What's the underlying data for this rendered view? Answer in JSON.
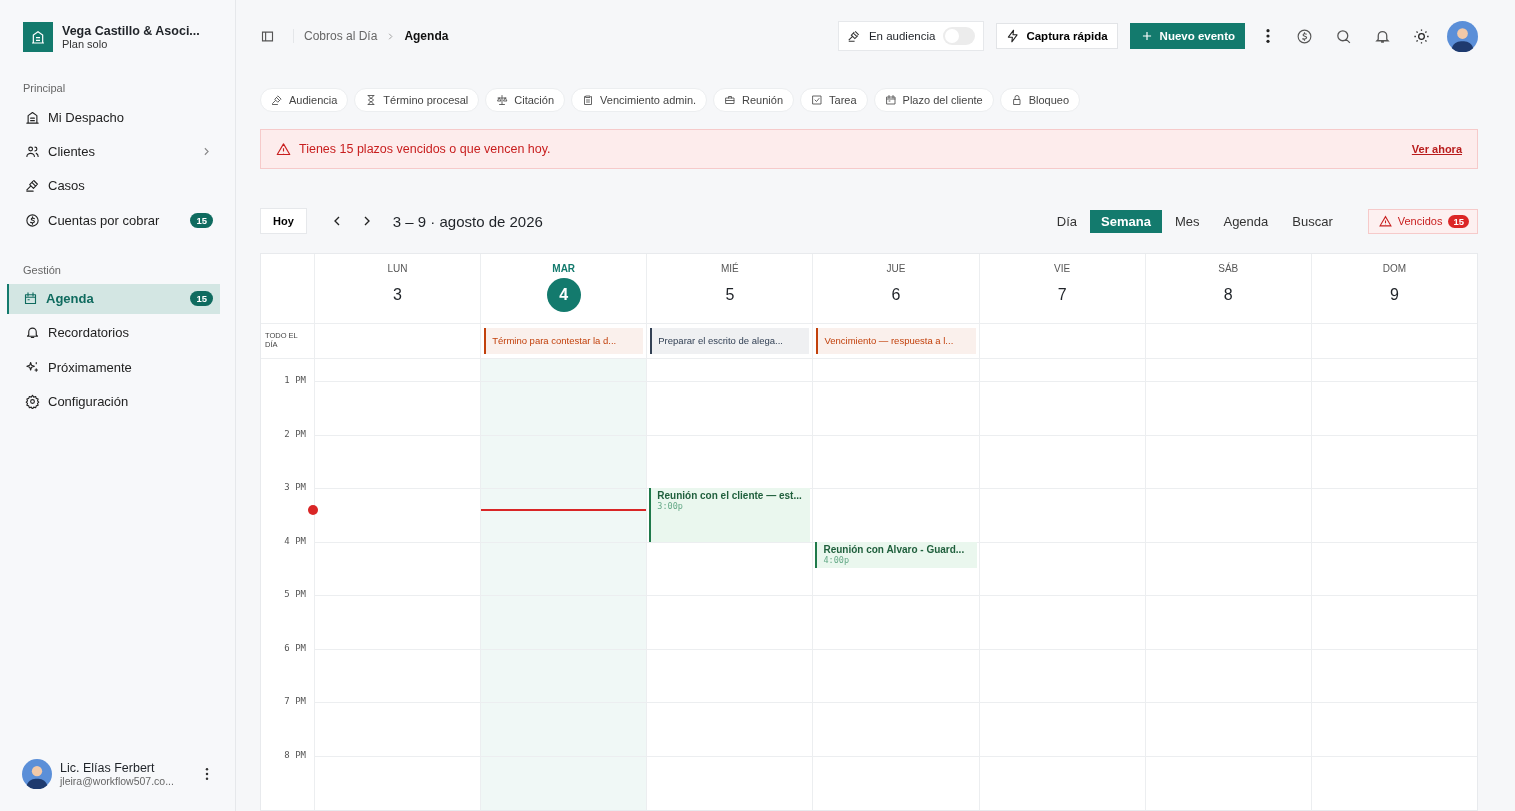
{
  "sidebar": {
    "org": {
      "name": "Vega Castillo & Asoci...",
      "plan": "Plan solo"
    },
    "sections": [
      {
        "title": "Principal",
        "items": [
          {
            "label": "Mi Despacho",
            "selected": false
          },
          {
            "label": "Clientes",
            "selected": false,
            "chevron": true
          },
          {
            "label": "Casos",
            "selected": false
          },
          {
            "label": "Cuentas por cobrar",
            "selected": false,
            "badge": "15"
          }
        ]
      },
      {
        "title": "Gestión",
        "items": [
          {
            "label": "Agenda",
            "selected": true,
            "badge": "15"
          },
          {
            "label": "Recordatorios",
            "selected": false
          },
          {
            "label": "Próximamente",
            "selected": false
          },
          {
            "label": "Configuración",
            "selected": false
          }
        ]
      }
    ],
    "user": {
      "name": "Lic. Elías Ferbert",
      "email": "jleira@workflow507.co..."
    }
  },
  "header": {
    "breadcrumb": [
      "Cobros al Día",
      "Agenda"
    ],
    "hearing_toggle": {
      "label": "En audiencia",
      "on": false
    },
    "quick_capture": "Captura rápida",
    "new_event": "Nuevo evento"
  },
  "filters": [
    "Audiencia",
    "Término procesal",
    "Citación",
    "Vencimiento admin.",
    "Reunión",
    "Tarea",
    "Plazo del cliente",
    "Bloqueo"
  ],
  "alert": {
    "text": "Tienes 15 plazos vencidos o que vencen hoy.",
    "link": "Ver ahora"
  },
  "toolbar": {
    "today": "Hoy",
    "range": "3 – 9 · agosto de 2026",
    "views": [
      {
        "label": "Día",
        "selected": false
      },
      {
        "label": "Semana",
        "selected": true
      },
      {
        "label": "Mes",
        "selected": false
      },
      {
        "label": "Agenda",
        "selected": false
      },
      {
        "label": "Buscar",
        "selected": false
      }
    ],
    "overdue": {
      "label": "Vencidos",
      "count": "15"
    }
  },
  "calendar": {
    "all_day_label": "TODO EL DÍA",
    "hours": [
      "1 PM",
      "2 PM",
      "3 PM",
      "4 PM",
      "5 PM",
      "6 PM",
      "7 PM",
      "8 PM"
    ],
    "days": [
      {
        "dow": "LUN",
        "date": "3",
        "today": false
      },
      {
        "dow": "MAR",
        "date": "4",
        "today": true,
        "all_day": {
          "title": "Término para contestar la d...",
          "color": "#c2410c"
        }
      },
      {
        "dow": "MIÉ",
        "date": "5",
        "today": false,
        "all_day": {
          "title": "Preparar el escrito de alega...",
          "color": "#334155"
        },
        "events": [
          {
            "title": "Reunión con el cliente — est...",
            "time": "3:00p",
            "kind": "hour"
          }
        ]
      },
      {
        "dow": "JUE",
        "date": "6",
        "today": false,
        "all_day": {
          "title": "Vencimiento — respuesta a l...",
          "color": "#c2410c"
        },
        "events": [
          {
            "title": "Reunión con Alvaro - Guard...",
            "time": "4:00p",
            "kind": "half"
          }
        ]
      },
      {
        "dow": "VIE",
        "date": "7",
        "today": false
      },
      {
        "dow": "SÁB",
        "date": "8",
        "today": false
      },
      {
        "dow": "DOM",
        "date": "9",
        "today": false
      }
    ]
  }
}
